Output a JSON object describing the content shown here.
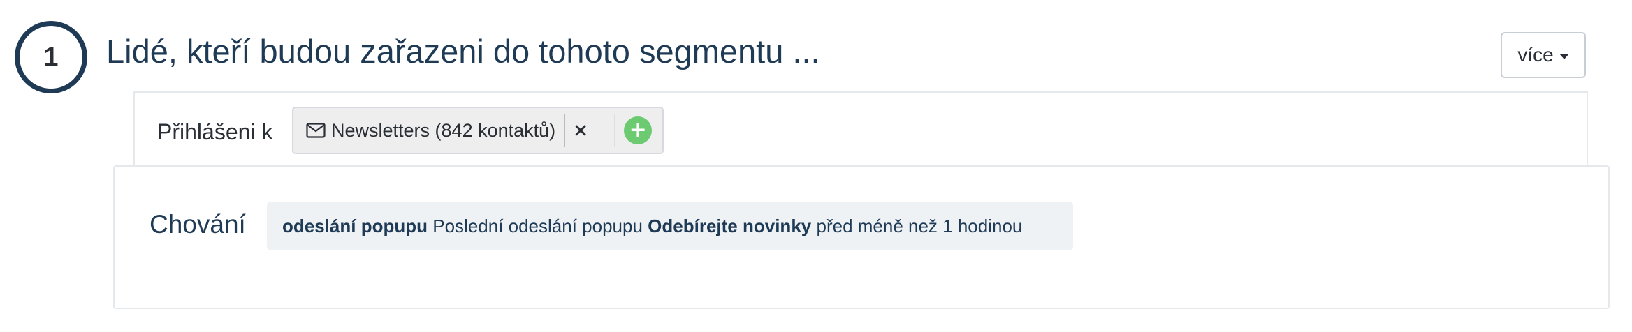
{
  "segment": {
    "step_number": "1",
    "title": "Lidé, kteří budou zařazeni do tohoto segmentu ..."
  },
  "header": {
    "more_label": "více",
    "more_icon": "chevron-down-icon"
  },
  "subscription": {
    "label": "Přihlášeni k",
    "list_icon": "envelope-icon",
    "list_tag": "Newsletters (842 kontaktů)",
    "remove_icon": "close-icon",
    "add_icon": "plus-circle-icon"
  },
  "behavior": {
    "label": "Chování",
    "condition": {
      "event": "odeslání popupu",
      "prefix": "Poslední odeslání popupu",
      "popup_name": "Odebírejte novinky",
      "timeframe": "před méně než 1 hodinou"
    }
  },
  "colors": {
    "primary_text": "#1f3a54",
    "add_button": "#6ccb70",
    "pill_background": "#eef2f5"
  }
}
